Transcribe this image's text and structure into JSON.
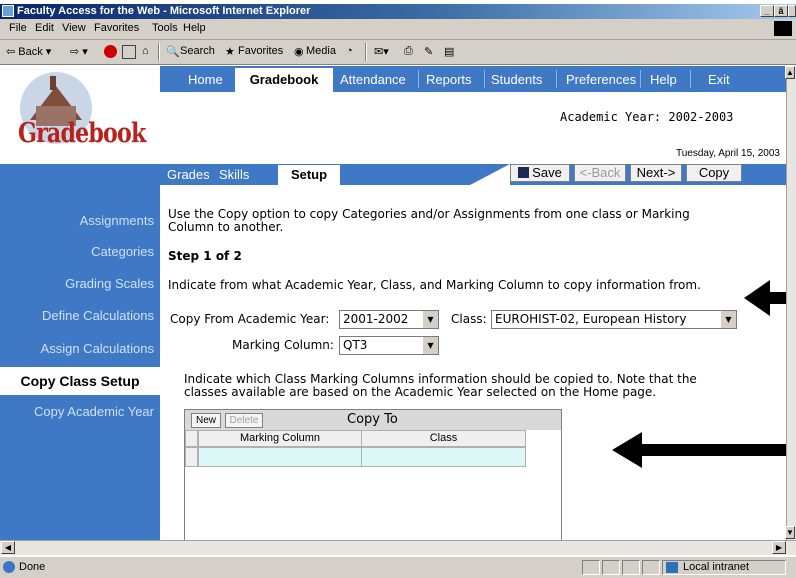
{
  "window": {
    "title": "Faculty Access for the Web - Microsoft Internet Explorer",
    "controls": [
      "_",
      "ã",
      "×"
    ]
  },
  "menubar": [
    "File",
    "Edit",
    "View",
    "Favorites",
    "Tools",
    "Help"
  ],
  "toolbar": {
    "back": "⇦ Back ▾",
    "forward": "⇨ ▾",
    "search": "Search",
    "favorites": "Favorites",
    "media": "Media"
  },
  "app": {
    "logo_text": "Gradebook",
    "nav": [
      "Home",
      "Gradebook",
      "Attendance",
      "Reports",
      "Students",
      "Preferences",
      "Help",
      "Exit"
    ],
    "nav_active": "Gradebook",
    "academic_year": "Academic Year: 2002-2003",
    "date": "Tuesday, April 15, 2003",
    "subnav": [
      "Grades",
      "Skills",
      "Setup"
    ],
    "subnav_active": "Setup",
    "buttons": {
      "save": "Save",
      "back": "<-Back",
      "next": "Next->",
      "copy": "Copy"
    },
    "left_nav": [
      "Assignments",
      "Categories",
      "Grading Scales",
      "Define Calculations",
      "Assign Calculations",
      "Copy Class Setup",
      "Copy Academic Year"
    ],
    "left_nav_active": "Copy Class Setup"
  },
  "content": {
    "intro_line1": "Use the Copy option to copy Categories and/or Assignments from one class or Marking",
    "intro_line2": "Column to another.",
    "step": "Step 1 of 2",
    "indicate_from": "Indicate from what Academic Year, Class, and Marking Column to copy information from.",
    "copy_from_label": "Copy From Academic Year:",
    "copy_from_value": "2001-2002",
    "class_label": "Class:",
    "class_value": "EUROHIST-02, European History",
    "marking_label": "Marking Column:",
    "marking_value": "QT3",
    "indicate_to_line1": "Indicate which Class Marking Columns information should be copied to. Note that the",
    "indicate_to_line2": "classes available are based on the Academic Year selected on the Home page.",
    "copy_to_title": "Copy To",
    "new_label": "New",
    "delete_label": "Delete",
    "col_marking": "Marking Column",
    "col_class": "Class"
  },
  "status": {
    "text": "Done",
    "zone": "Local intranet"
  }
}
